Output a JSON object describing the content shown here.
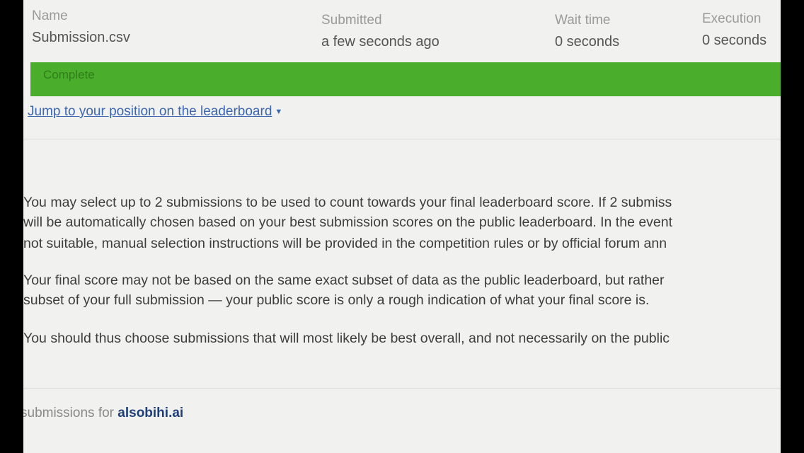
{
  "submission_table": {
    "columns": [
      {
        "header": "Name",
        "value": "Submission.csv"
      },
      {
        "header": "Submitted",
        "value": "a few seconds ago"
      },
      {
        "header": "Wait time",
        "value": "0 seconds"
      },
      {
        "header": "Execution",
        "value": "0 seconds"
      }
    ]
  },
  "status": {
    "label": "Complete",
    "color": "#4aad2b"
  },
  "leaderboard_link": {
    "label": "Jump to your position on the leaderboard",
    "icon": "caret-down-icon"
  },
  "info": {
    "paragraph1": [
      "You may select up to 2 submissions to be used to count towards your final leaderboard score. If 2 submiss",
      "will be automatically chosen based on your best submission scores on the public leaderboard. In the event",
      "not suitable, manual selection instructions will be provided in the competition rules or by official forum ann"
    ],
    "paragraph2": [
      "Your final score may not be based on the same exact subset of data as the public leaderboard, but rather",
      "subset of your full submission — your public score is only a rough indication of what your final score is."
    ],
    "paragraph3": [
      "You should thus choose submissions that will most likely be best overall, and not necessarily on the public"
    ]
  },
  "footer": {
    "prefix": "submissions for",
    "username": "alsobihi.ai"
  }
}
